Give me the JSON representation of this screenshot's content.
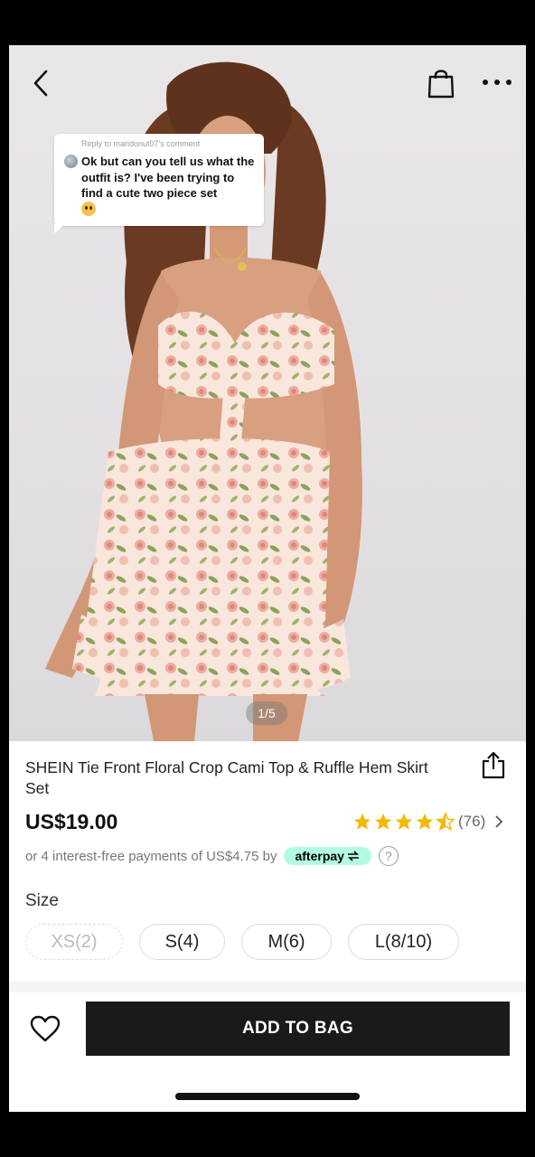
{
  "gallery": {
    "counter": "1/5"
  },
  "comment": {
    "reply_to": "Reply to maridonut07's comment",
    "text": "Ok but can you tell us what the outfit is? I've been trying to find a cute two piece set"
  },
  "product": {
    "title": "SHEIN Tie Front Floral Crop Cami Top & Ruffle Hem Skirt Set",
    "price": "US$19.00",
    "rating_stars": 4.5,
    "review_count": "(76)",
    "installments_text": "or 4 interest-free payments of US$4.75 by",
    "afterpay_label": "afterpay",
    "help_symbol": "?"
  },
  "size": {
    "label": "Size",
    "options": [
      {
        "label": "XS(2)",
        "available": false
      },
      {
        "label": "S(4)",
        "available": true
      },
      {
        "label": "M(6)",
        "available": true
      },
      {
        "label": "L(8/10)",
        "available": true
      }
    ]
  },
  "actions": {
    "add_to_bag": "ADD TO BAG"
  },
  "colors": {
    "accent": "#1a1a1a",
    "star": "#f5b800",
    "afterpay": "#b2fce4"
  }
}
